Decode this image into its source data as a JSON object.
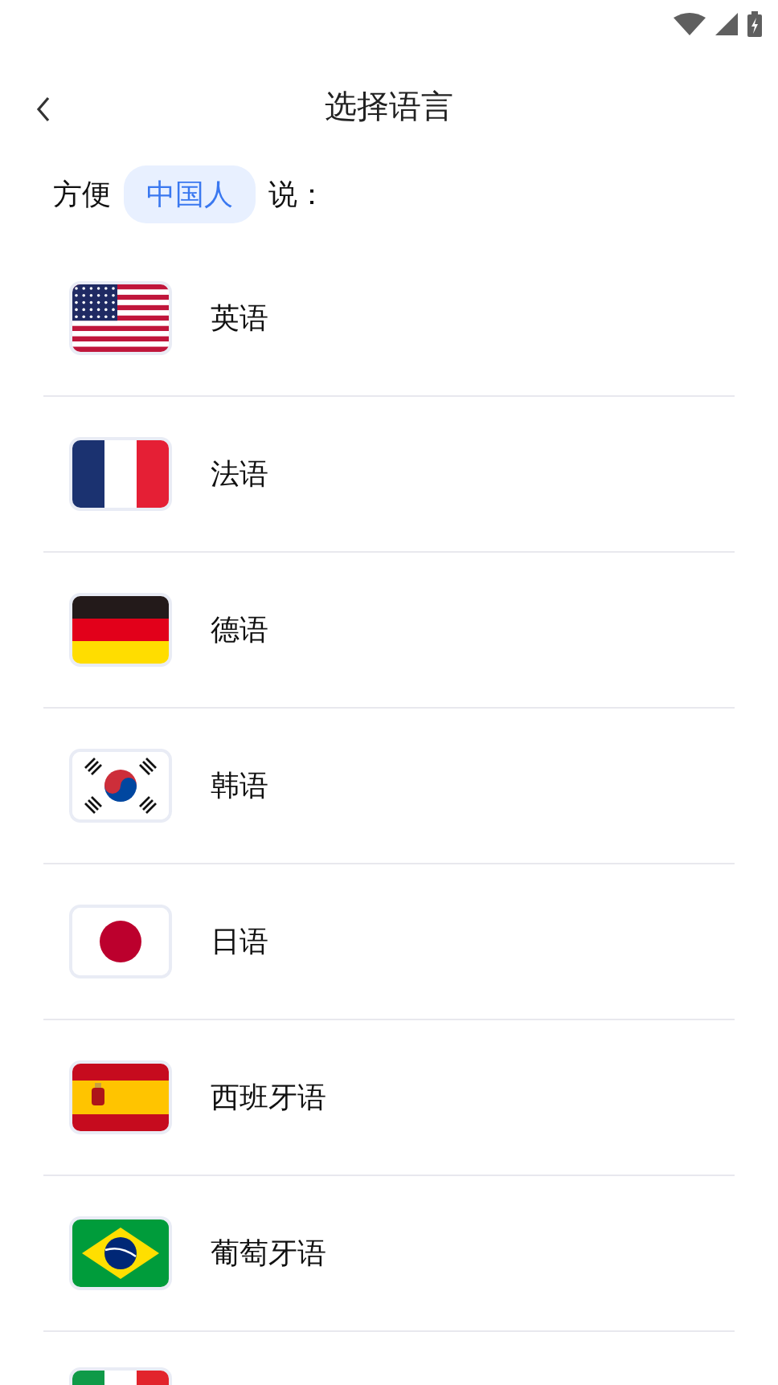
{
  "header": {
    "title": "选择语言"
  },
  "prompt": {
    "before": "方便",
    "chip": "中国人",
    "after": "说："
  },
  "languages": [
    {
      "kind": "us",
      "label": "英语"
    },
    {
      "kind": "fr",
      "label": "法语"
    },
    {
      "kind": "de",
      "label": "德语"
    },
    {
      "kind": "kr",
      "label": "韩语"
    },
    {
      "kind": "jp",
      "label": "日语"
    },
    {
      "kind": "es",
      "label": "西班牙语"
    },
    {
      "kind": "br",
      "label": "葡萄牙语"
    },
    {
      "kind": "it"
    }
  ]
}
